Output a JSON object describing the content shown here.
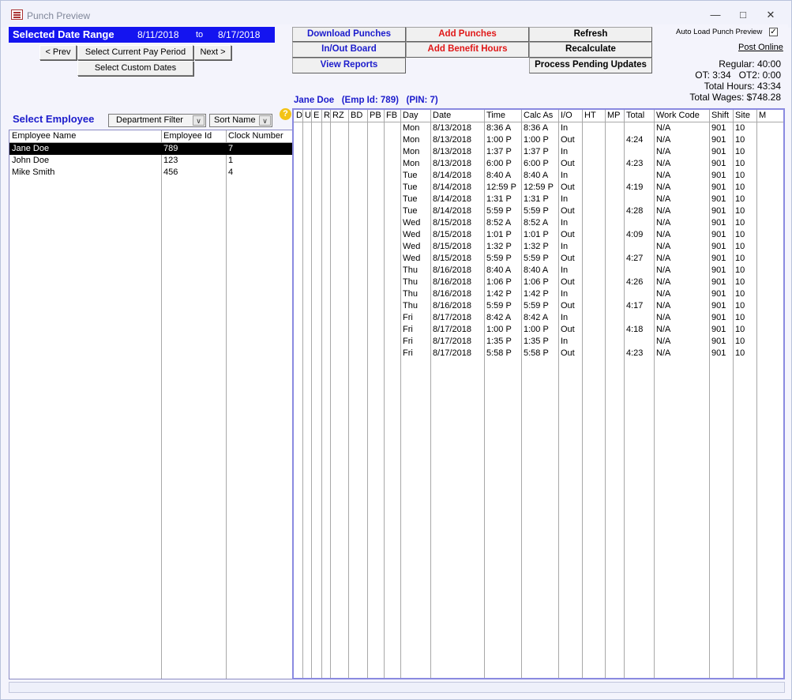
{
  "window": {
    "title": "Punch Preview",
    "icon": "access-form-icon"
  },
  "date_range": {
    "label": "Selected Date Range",
    "start": "8/11/2018",
    "to": "to",
    "end": "8/17/2018"
  },
  "nav": {
    "prev": "< Prev",
    "current_period": "Select Current Pay Period",
    "next": "Next >",
    "custom": "Select Custom Dates"
  },
  "actions": {
    "download": "Download Punches",
    "add_punches": "Add Punches",
    "refresh": "Refresh",
    "inout": "In/Out Board",
    "benefit": "Add Benefit Hours",
    "recalc": "Recalculate",
    "reports": "View Reports",
    "pending": "Process Pending Updates"
  },
  "options": {
    "auto_load": "Auto Load Punch Preview",
    "auto_load_checked": "✓",
    "post_online": "Post Online"
  },
  "summary": {
    "regular": "Regular: 40:00",
    "ot": "OT: 3:34   OT2: 0:00",
    "total_hours": "Total Hours: 43:34",
    "total_wages": "Total Wages: $748.28"
  },
  "employee_panel": {
    "title": "Select Employee",
    "department_filter": "Department Filter",
    "sort": "Sort Name",
    "help_icon": "question-icon",
    "headers": [
      "Employee Name",
      "Employee Id",
      "Clock Number"
    ],
    "rows": [
      {
        "name": "Jane Doe",
        "id": "789",
        "clock": "7"
      },
      {
        "name": "John Doe",
        "id": "123",
        "clock": "1"
      },
      {
        "name": "Mike Smith",
        "id": "456",
        "clock": "4"
      }
    ]
  },
  "punch_panel": {
    "title": "Jane Doe   (Emp Id: 789)   (PIN: 7)",
    "headers": [
      "D",
      "U",
      "E",
      "R",
      "RZ",
      "BD",
      "PB",
      "FB",
      "Day",
      "Date",
      "Time",
      "Calc As",
      "I/O",
      "HT",
      "MP",
      "Total",
      "Work Code",
      "Shift",
      "Site",
      "M"
    ],
    "rows": [
      {
        "day": "Mon",
        "date": "8/13/2018",
        "time": "8:36 A",
        "calc": "8:36 A",
        "io": "In",
        "total": "",
        "code": "N/A",
        "shift": "901",
        "site": "10"
      },
      {
        "day": "Mon",
        "date": "8/13/2018",
        "time": "1:00 P",
        "calc": "1:00 P",
        "io": "Out",
        "total": "4:24",
        "code": "N/A",
        "shift": "901",
        "site": "10"
      },
      {
        "day": "Mon",
        "date": "8/13/2018",
        "time": "1:37 P",
        "calc": "1:37 P",
        "io": "In",
        "total": "",
        "code": "N/A",
        "shift": "901",
        "site": "10"
      },
      {
        "day": "Mon",
        "date": "8/13/2018",
        "time": "6:00 P",
        "calc": "6:00 P",
        "io": "Out",
        "total": "4:23",
        "code": "N/A",
        "shift": "901",
        "site": "10"
      },
      {
        "day": "Tue",
        "date": "8/14/2018",
        "time": "8:40 A",
        "calc": "8:40 A",
        "io": "In",
        "total": "",
        "code": "N/A",
        "shift": "901",
        "site": "10"
      },
      {
        "day": "Tue",
        "date": "8/14/2018",
        "time": "12:59 P",
        "calc": "12:59 P",
        "io": "Out",
        "total": "4:19",
        "code": "N/A",
        "shift": "901",
        "site": "10"
      },
      {
        "day": "Tue",
        "date": "8/14/2018",
        "time": "1:31 P",
        "calc": "1:31 P",
        "io": "In",
        "total": "",
        "code": "N/A",
        "shift": "901",
        "site": "10"
      },
      {
        "day": "Tue",
        "date": "8/14/2018",
        "time": "5:59 P",
        "calc": "5:59 P",
        "io": "Out",
        "total": "4:28",
        "code": "N/A",
        "shift": "901",
        "site": "10"
      },
      {
        "day": "Wed",
        "date": "8/15/2018",
        "time": "8:52 A",
        "calc": "8:52 A",
        "io": "In",
        "total": "",
        "code": "N/A",
        "shift": "901",
        "site": "10"
      },
      {
        "day": "Wed",
        "date": "8/15/2018",
        "time": "1:01 P",
        "calc": "1:01 P",
        "io": "Out",
        "total": "4:09",
        "code": "N/A",
        "shift": "901",
        "site": "10"
      },
      {
        "day": "Wed",
        "date": "8/15/2018",
        "time": "1:32 P",
        "calc": "1:32 P",
        "io": "In",
        "total": "",
        "code": "N/A",
        "shift": "901",
        "site": "10"
      },
      {
        "day": "Wed",
        "date": "8/15/2018",
        "time": "5:59 P",
        "calc": "5:59 P",
        "io": "Out",
        "total": "4:27",
        "code": "N/A",
        "shift": "901",
        "site": "10"
      },
      {
        "day": "Thu",
        "date": "8/16/2018",
        "time": "8:40 A",
        "calc": "8:40 A",
        "io": "In",
        "total": "",
        "code": "N/A",
        "shift": "901",
        "site": "10"
      },
      {
        "day": "Thu",
        "date": "8/16/2018",
        "time": "1:06 P",
        "calc": "1:06 P",
        "io": "Out",
        "total": "4:26",
        "code": "N/A",
        "shift": "901",
        "site": "10"
      },
      {
        "day": "Thu",
        "date": "8/16/2018",
        "time": "1:42 P",
        "calc": "1:42 P",
        "io": "In",
        "total": "",
        "code": "N/A",
        "shift": "901",
        "site": "10"
      },
      {
        "day": "Thu",
        "date": "8/16/2018",
        "time": "5:59 P",
        "calc": "5:59 P",
        "io": "Out",
        "total": "4:17",
        "code": "N/A",
        "shift": "901",
        "site": "10"
      },
      {
        "day": "Fri",
        "date": "8/17/2018",
        "time": "8:42 A",
        "calc": "8:42 A",
        "io": "In",
        "total": "",
        "code": "N/A",
        "shift": "901",
        "site": "10"
      },
      {
        "day": "Fri",
        "date": "8/17/2018",
        "time": "1:00 P",
        "calc": "1:00 P",
        "io": "Out",
        "total": "4:18",
        "code": "N/A",
        "shift": "901",
        "site": "10"
      },
      {
        "day": "Fri",
        "date": "8/17/2018",
        "time": "1:35 P",
        "calc": "1:35 P",
        "io": "In",
        "total": "",
        "code": "N/A",
        "shift": "901",
        "site": "10"
      },
      {
        "day": "Fri",
        "date": "8/17/2018",
        "time": "5:58 P",
        "calc": "5:58 P",
        "io": "Out",
        "total": "4:23",
        "code": "N/A",
        "shift": "901",
        "site": "10"
      }
    ]
  }
}
